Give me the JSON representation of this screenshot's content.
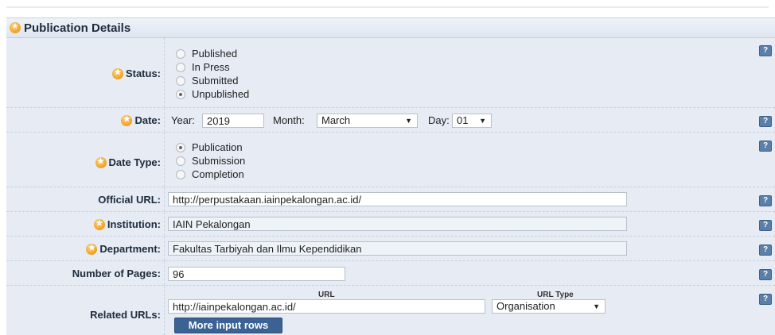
{
  "section": {
    "title": "Publication Details"
  },
  "status": {
    "label": "Status:",
    "options": [
      "Published",
      "In Press",
      "Submitted",
      "Unpublished"
    ],
    "selected": "Unpublished"
  },
  "date": {
    "label": "Date:",
    "year_label": "Year:",
    "year_value": "2019",
    "month_label": "Month:",
    "month_value": "March",
    "day_label": "Day:",
    "day_value": "01"
  },
  "date_type": {
    "label": "Date Type:",
    "options": [
      "Publication",
      "Submission",
      "Completion"
    ],
    "selected": "Publication"
  },
  "official_url": {
    "label": "Official URL:",
    "value": "http://perpustakaan.iainpekalongan.ac.id/"
  },
  "institution": {
    "label": "Institution:",
    "value": "IAIN Pekalongan"
  },
  "department": {
    "label": "Department:",
    "value": "Fakultas Tarbiyah dan Ilmu Kependidikan"
  },
  "pages": {
    "label": "Number of Pages:",
    "value": "96"
  },
  "related_urls": {
    "label": "Related URLs:",
    "url_header": "URL",
    "type_header": "URL Type",
    "url_value": "http://iainpekalongan.ac.id/",
    "type_value": "Organisation",
    "more_button": "More input rows"
  },
  "help_glyph": "?",
  "colors": {
    "panel_bg": "#e6ebf4",
    "button_bg": "#3a6394",
    "help_bg": "#5a7fa8",
    "star": "#f0a020"
  }
}
